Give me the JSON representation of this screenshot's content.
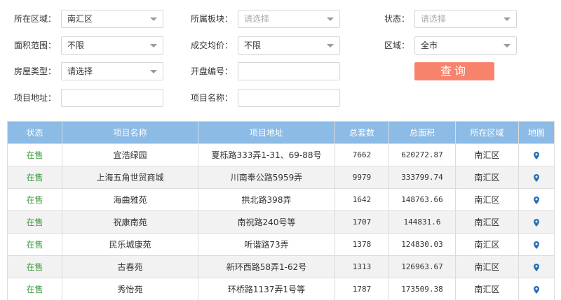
{
  "filters": {
    "district": {
      "label": "所在区域：",
      "value": "南汇区"
    },
    "block": {
      "label": "所属板块：",
      "placeholder": "请选择"
    },
    "status": {
      "label": "状态：",
      "placeholder": "请选择"
    },
    "area_range": {
      "label": "面积范围：",
      "value": "不限"
    },
    "avg_price": {
      "label": "成交均价：",
      "value": "不限"
    },
    "region": {
      "label": "区域：",
      "value": "全市"
    },
    "house_type": {
      "label": "房屋类型：",
      "placeholder": "请选择"
    },
    "opening_no": {
      "label": "开盘编号：",
      "value": ""
    },
    "project_address": {
      "label": "项目地址：",
      "value": ""
    },
    "project_name": {
      "label": "项目名称：",
      "value": ""
    },
    "search_label": "查询"
  },
  "table": {
    "headers": [
      "状态",
      "项目名称",
      "项目地址",
      "总套数",
      "总面积",
      "所在区域",
      "地图"
    ],
    "rows": [
      [
        "在售",
        "宜浩绿园",
        "夏栎路333弄1-31、69-88号",
        "7662",
        "620272.87",
        "南汇区"
      ],
      [
        "在售",
        "上海五角世贸商城",
        "川南奉公路5959弄",
        "9979",
        "333799.74",
        "南汇区"
      ],
      [
        "在售",
        "海曲雅苑",
        "拱北路398弄",
        "1642",
        "148763.66",
        "南汇区"
      ],
      [
        "在售",
        "祝康南苑",
        "南祝路240号等",
        "1707",
        "144831.6",
        "南汇区"
      ],
      [
        "在售",
        "民乐城康苑",
        "听谐路73弄",
        "1378",
        "124830.03",
        "南汇区"
      ],
      [
        "在售",
        "古春苑",
        "新环西路58弄1-62号",
        "1313",
        "126963.67",
        "南汇区"
      ],
      [
        "在售",
        "秀怡苑",
        "环桥路1137弄1号等",
        "1787",
        "173509.38",
        "南汇区"
      ]
    ],
    "map_icon": "location-pin-icon"
  },
  "colors": {
    "header_bg": "#8cbbe6",
    "status_green": "#3a9a3a",
    "search_btn": "#f7836d",
    "pin": "#2a6fb4"
  }
}
